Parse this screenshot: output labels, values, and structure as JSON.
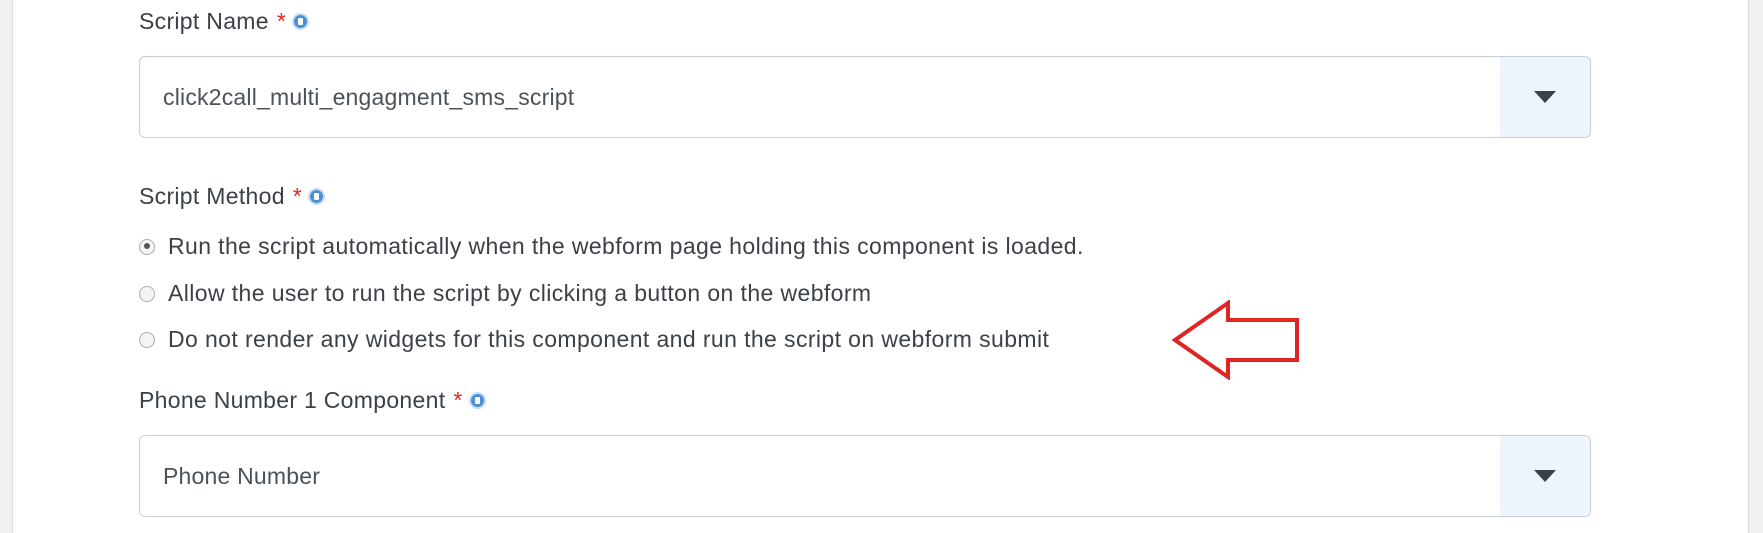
{
  "script_name": {
    "label": "Script Name",
    "required_mark": "*",
    "value": "click2call_multi_engagment_sms_script"
  },
  "script_method": {
    "label": "Script Method",
    "required_mark": "*",
    "options": [
      {
        "label": "Run the script automatically when the webform page holding this component is loaded.",
        "checked": true
      },
      {
        "label": "Allow the user to run the script by clicking a button on the webform",
        "checked": false
      },
      {
        "label": "Do not render any widgets for this component and run the script on webform submit",
        "checked": false
      }
    ]
  },
  "phone_number_1_component": {
    "label": "Phone Number 1 Component",
    "required_mark": "*",
    "value": "Phone Number"
  },
  "annotation": {
    "icon": "red-arrow-left-icon",
    "color": "#e02424"
  }
}
